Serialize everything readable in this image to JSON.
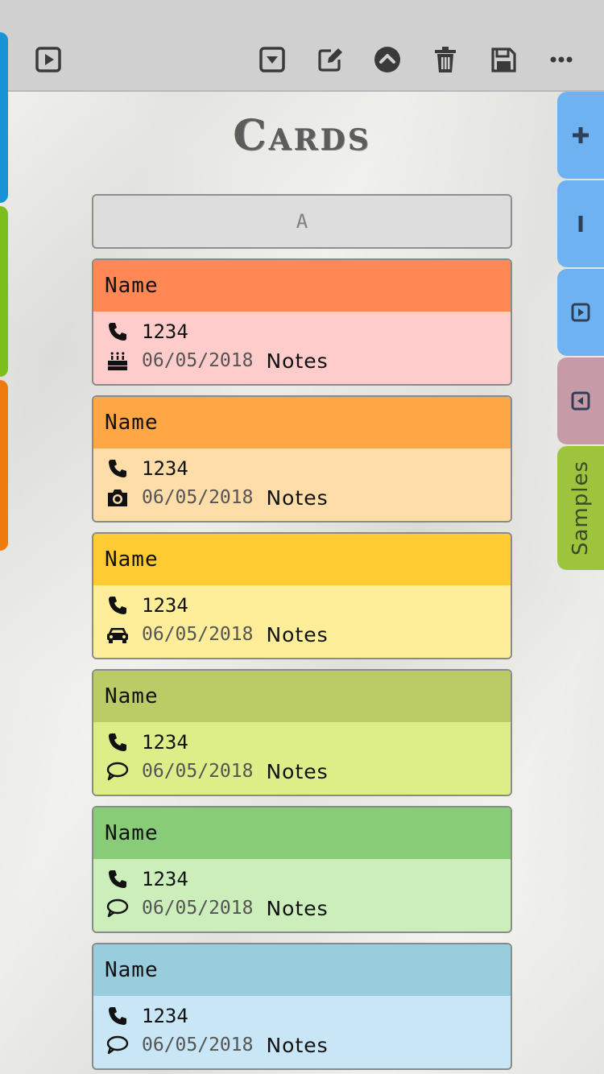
{
  "toolbar": {
    "icons": [
      "play-square-icon",
      "caret-down-square-icon",
      "edit-icon",
      "chevron-up-circle-icon",
      "trash-icon",
      "save-icon",
      "more-icon"
    ]
  },
  "side_tabs": {
    "left_colors": [
      "#1793d6",
      "#7cbf1c",
      "#ef7b0c"
    ],
    "right": [
      {
        "icon": "plus-icon",
        "color": "#6fb2f2"
      },
      {
        "icon": "minus-icon",
        "color": "#6fb2f2"
      },
      {
        "icon": "next-icon",
        "color": "#6fb2f2"
      },
      {
        "icon": "previous-icon",
        "color": "#c79aa8"
      },
      {
        "label": "Samples",
        "color": "#9dc43c"
      }
    ]
  },
  "title": "Cards",
  "search": {
    "value": "A"
  },
  "cards": [
    {
      "name": "Name",
      "phone": "1234",
      "date": "06/05/2018",
      "notes": "Notes",
      "icon": "birthday-cake-icon",
      "header_color": "#ff8855",
      "body_color": "#ffcccc"
    },
    {
      "name": "Name",
      "phone": "1234",
      "date": "06/05/2018",
      "notes": "Notes",
      "icon": "camera-icon",
      "header_color": "#ffa745",
      "body_color": "#fedda8"
    },
    {
      "name": "Name",
      "phone": "1234",
      "date": "06/05/2018",
      "notes": "Notes",
      "icon": "car-icon",
      "header_color": "#ffcb33",
      "body_color": "#ffee99"
    },
    {
      "name": "Name",
      "phone": "1234",
      "date": "06/05/2018",
      "notes": "Notes",
      "icon": "comment-icon",
      "header_color": "#bbcc66",
      "body_color": "#ddee88"
    },
    {
      "name": "Name",
      "phone": "1234",
      "date": "06/05/2018",
      "notes": "Notes",
      "icon": "comment-icon",
      "header_color": "#88cc77",
      "body_color": "#cceebb"
    },
    {
      "name": "Name",
      "phone": "1234",
      "date": "06/05/2018",
      "notes": "Notes",
      "icon": "comment-icon",
      "header_color": "#99ccdd",
      "body_color": "#c8e6f6"
    }
  ]
}
